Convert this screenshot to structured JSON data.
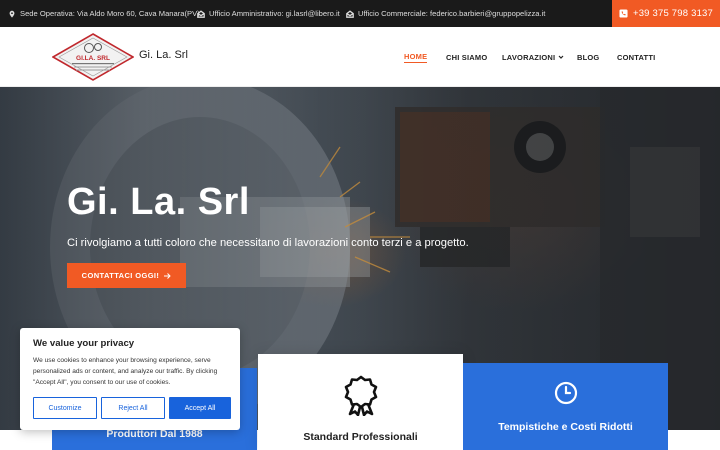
{
  "topbar": {
    "address": "Sede Operativa: Via Aldo Moro 60, Cava Manara(PV)",
    "admin": "Ufficio Amministrativo: gi.lasrl@libero.it",
    "commercial": "Ufficio Commerciale: federico.barbieri@gruppopelizza.it",
    "phone": "+39 375 798 3137"
  },
  "header": {
    "logo_text": "GI.LA. SRL",
    "brand": "Gi. La. Srl",
    "nav": [
      {
        "label": "HOME",
        "active": true
      },
      {
        "label": "CHI SIAMO"
      },
      {
        "label": "LAVORAZIONI",
        "has_dropdown": true
      },
      {
        "label": "BLOG"
      },
      {
        "label": "CONTATTI"
      }
    ]
  },
  "hero": {
    "title": "Gi. La. Srl",
    "subtitle": "Ci rivolgiamo a tutti coloro che necessitano di lavorazioni conto terzi e a progetto.",
    "cta": "CONTATTACI OGGI!"
  },
  "features": [
    {
      "title": "Produttori Dal 1988",
      "icon": "calendar-icon"
    },
    {
      "title": "Standard Professionali",
      "icon": "award-ribbon-icon"
    },
    {
      "title": "Tempistiche e Costi Ridotti",
      "icon": "clock-icon"
    }
  ],
  "cookie": {
    "title": "We value your privacy",
    "text": "We use cookies to enhance your browsing experience, serve personalized ads or content, and analyze our traffic. By clicking \"Accept All\", you consent to our use of cookies.",
    "customize": "Customize",
    "reject": "Reject All",
    "accept": "Accept All"
  },
  "colors": {
    "accent": "#f15a24",
    "blue": "#2a6fdb",
    "cookie_blue": "#1863dc",
    "topbar": "#1a1a1a"
  }
}
